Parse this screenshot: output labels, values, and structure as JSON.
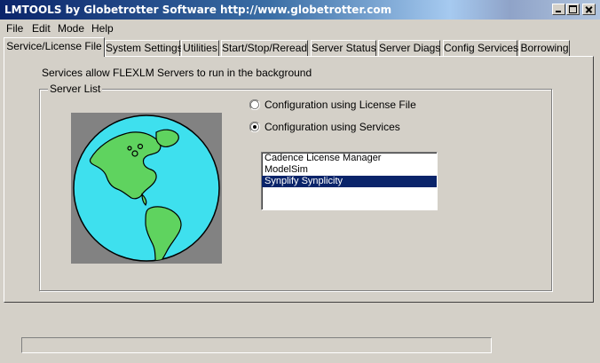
{
  "window": {
    "title": "LMTOOLS by Globetrotter Software http://www.globetrotter.com"
  },
  "menu": [
    "File",
    "Edit",
    "Mode",
    "Help"
  ],
  "tabs": [
    {
      "label": "Service/License File",
      "active": true
    },
    {
      "label": "System Settings",
      "active": false
    },
    {
      "label": "Utilities",
      "active": false
    },
    {
      "label": "Start/Stop/Reread",
      "active": false
    },
    {
      "label": "Server Status",
      "active": false
    },
    {
      "label": "Server Diags",
      "active": false
    },
    {
      "label": "Config Services",
      "active": false
    },
    {
      "label": "Borrowing",
      "active": false
    }
  ],
  "panel": {
    "description": "Services allow FLEXLM Servers to run in the background",
    "group_label": "Server List",
    "options": [
      {
        "label": "Configuration using License File",
        "selected": false
      },
      {
        "label": "Configuration using Services",
        "selected": true
      }
    ],
    "services": [
      {
        "label": "Cadence License Manager",
        "selected": false
      },
      {
        "label": "ModelSim",
        "selected": false
      },
      {
        "label": "Synplify Synplicity",
        "selected": true
      }
    ]
  },
  "status": {
    "text": ""
  },
  "colors": {
    "title_start": "#0a246a",
    "selection": "#0a246a",
    "globe_ocean": "#3ee0ee",
    "globe_land": "#5fd35f",
    "globe_background": "#828282"
  }
}
